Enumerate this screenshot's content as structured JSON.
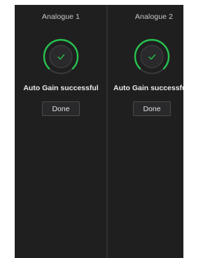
{
  "colors": {
    "panel_bg": "#1f1f20",
    "accent_green": "#27c34f",
    "knob_bg": "#2a2a2c",
    "track": "#3a3a3d"
  },
  "channels": [
    {
      "title": "Analogue 1",
      "status": "Auto Gain successful",
      "button": "Done",
      "icon": "check-icon"
    },
    {
      "title": "Analogue 2",
      "status": "Auto Gain successful",
      "button": "Done",
      "icon": "check-icon"
    }
  ]
}
